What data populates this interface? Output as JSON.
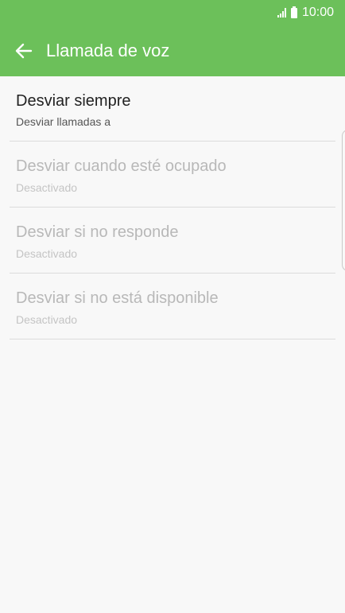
{
  "statusbar": {
    "time": "10:00"
  },
  "appbar": {
    "title": "Llamada de voz",
    "back_icon": "arrow-left-icon"
  },
  "items": [
    {
      "title": "Desviar siempre",
      "subtitle": "Desviar llamadas a",
      "enabled": true
    },
    {
      "title": "Desviar cuando esté ocupado",
      "subtitle": "Desactivado",
      "enabled": false
    },
    {
      "title": "Desviar si no responde",
      "subtitle": "Desactivado",
      "enabled": false
    },
    {
      "title": "Desviar si no está disponible",
      "subtitle": "Desactivado",
      "enabled": false
    }
  ],
  "colors": {
    "accent": "#6cc05a",
    "background": "#f8f8f8",
    "text_primary": "#222222",
    "text_disabled": "#b8b8b8"
  }
}
